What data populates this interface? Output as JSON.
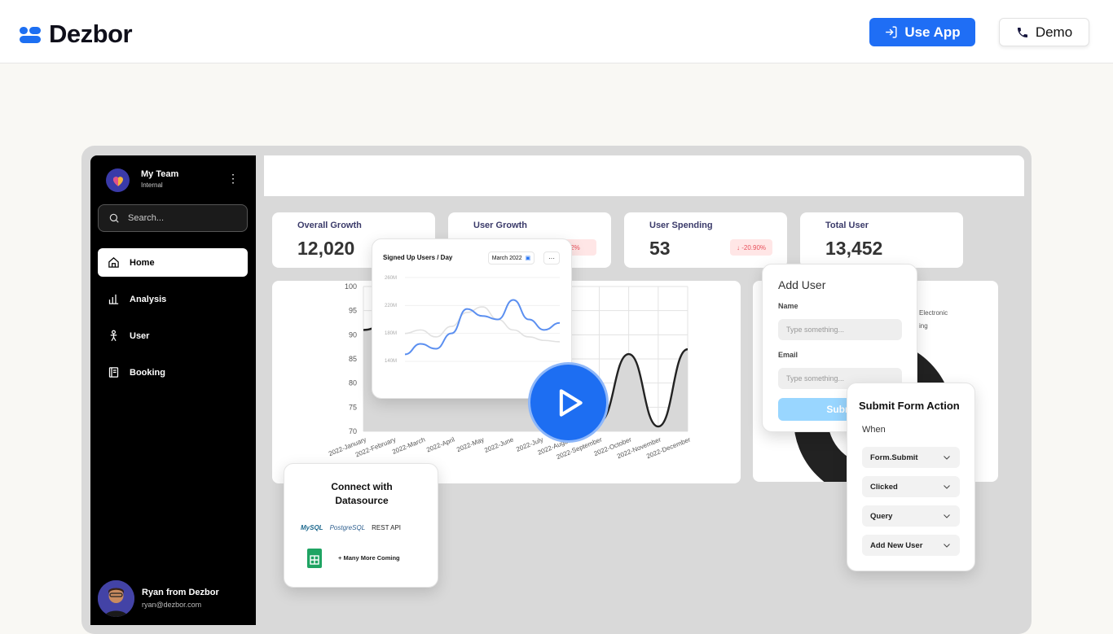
{
  "header": {
    "brand": "Dezbor",
    "use_app": "Use App",
    "demo": "Demo"
  },
  "sidebar": {
    "team_name": "My Team",
    "team_sub": "Internal",
    "search_placeholder": "Search...",
    "items": [
      {
        "label": "Home",
        "icon": "home-icon",
        "active": true
      },
      {
        "label": "Analysis",
        "icon": "bar-chart-icon"
      },
      {
        "label": "User",
        "icon": "user-icon"
      },
      {
        "label": "Booking",
        "icon": "booking-icon"
      }
    ],
    "user_name": "Ryan from Dezbor",
    "user_email": "ryan@dezbor.com"
  },
  "stats": [
    {
      "title": "Overall Growth",
      "value": "12,020"
    },
    {
      "title": "User Growth",
      "value": "",
      "badge": "2%"
    },
    {
      "title": "User Spending",
      "value": "53",
      "badge": "↓ -20.90%"
    },
    {
      "title": "Total User",
      "value": "13,452"
    }
  ],
  "chart_data": [
    {
      "type": "area",
      "title": "",
      "y_ticks": [
        "100",
        "95",
        "90",
        "85",
        "80",
        "75",
        "70"
      ],
      "ylim": [
        70,
        100
      ],
      "categories": [
        "2022-January",
        "2022-February",
        "2022-March",
        "2022-April",
        "2022-May",
        "2022-June",
        "2022-July",
        "2022-August",
        "2022-September",
        "2022-October",
        "2022-November",
        "2022-December"
      ],
      "series": [
        {
          "values": [
            91,
            93,
            95,
            89,
            84,
            81,
            78,
            74,
            72,
            86,
            71,
            87
          ]
        }
      ]
    },
    {
      "type": "line",
      "title": "Signed Up Users / Day",
      "date_filter": "March 2022",
      "y_ticks": [
        "260M",
        "220M",
        "180M",
        "140M"
      ],
      "ylim": [
        140,
        260
      ],
      "series": [
        {
          "values": [
            150,
            165,
            158,
            180,
            215,
            205,
            200,
            228,
            200,
            185,
            195
          ]
        },
        {
          "values": [
            180,
            185,
            175,
            190,
            210,
            218,
            200,
            185,
            175,
            170,
            168
          ]
        }
      ]
    }
  ],
  "right_panel": {
    "legend_1": "Electronic",
    "legend_2": "ing"
  },
  "add_user": {
    "title": "Add User",
    "name_label": "Name",
    "name_placeholder": "Type something...",
    "email_label": "Email",
    "email_placeholder": "Type something...",
    "submit": "Subm"
  },
  "form_action": {
    "title": "Submit Form Action",
    "when": "When",
    "selects": [
      "Form.Submit",
      "Clicked",
      "Query",
      "Add New User"
    ]
  },
  "connect": {
    "title_1": "Connect with",
    "title_2": "Datasource",
    "mysql": "MySQL",
    "postgres": "PostgreSQL",
    "rest": "REST API",
    "more": "+ Many More Coming"
  },
  "colors": {
    "accent": "#1f6ef5",
    "sidebar": "#000000",
    "background": "#f9f8f4"
  }
}
